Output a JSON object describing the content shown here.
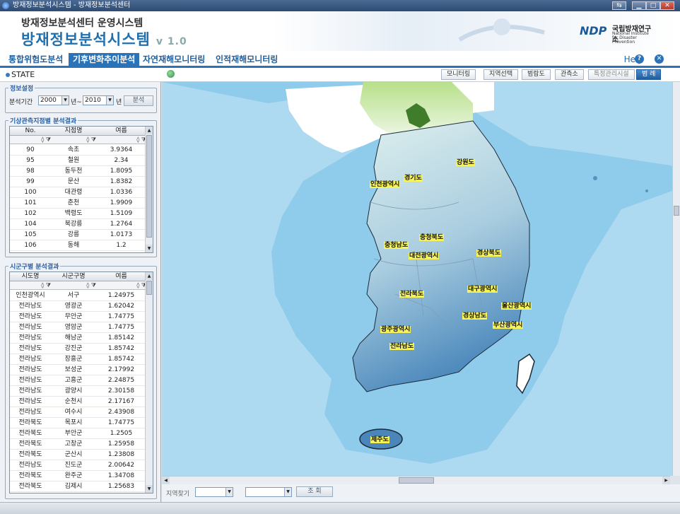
{
  "window": {
    "title": "방재정보분석시스템 - 방재정보분석센터"
  },
  "header": {
    "subtitle": "방재정보분석센터 운영시스템",
    "title": "방재정보분석시스템",
    "version": "v 1.0",
    "logo_mark": "NDP",
    "logo_kr": "국립방재연구소",
    "logo_en1": "National Institute",
    "logo_en2": "for Disaster Prevention"
  },
  "menu": {
    "items": [
      "통합위험도분석",
      "기후변화추이분석",
      "자연재해모니터링",
      "인적재해모니터링"
    ],
    "active": 1,
    "help": "Help"
  },
  "state": {
    "label": "STATE"
  },
  "toolbar": {
    "buttons": [
      "모니터링",
      "지역선택",
      "범람도",
      "관측소",
      "특정관리시설",
      "범 례"
    ]
  },
  "info": {
    "legend": "정보설정",
    "period_label": "분석기간",
    "from_year": "2000",
    "to_sep": "년~",
    "to_year": "2010",
    "year_suffix": "년",
    "analyze": "분석"
  },
  "station": {
    "legend": "기상관측지점별 분석결과",
    "headers": [
      "No.",
      "지점명",
      "여름"
    ],
    "rows": [
      [
        "90",
        "속초",
        "3.9364"
      ],
      [
        "95",
        "철원",
        "2.34"
      ],
      [
        "98",
        "동두천",
        "1.8095"
      ],
      [
        "99",
        "문산",
        "1.8382"
      ],
      [
        "100",
        "대관령",
        "1.0336"
      ],
      [
        "101",
        "춘천",
        "1.9909"
      ],
      [
        "102",
        "백령도",
        "1.5109"
      ],
      [
        "104",
        "북강릉",
        "1.2764"
      ],
      [
        "105",
        "강릉",
        "1.0173"
      ],
      [
        "106",
        "동해",
        "1.2"
      ]
    ]
  },
  "district": {
    "legend": "시군구별 분석결과",
    "headers": [
      "시도명",
      "시군구명",
      "여름"
    ],
    "rows": [
      [
        "인천광역시",
        "서구",
        "1.24975"
      ],
      [
        "전라남도",
        "영광군",
        "1.62042"
      ],
      [
        "전라남도",
        "무안군",
        "1.74775"
      ],
      [
        "전라남도",
        "영암군",
        "1.74775"
      ],
      [
        "전라남도",
        "해남군",
        "1.85142"
      ],
      [
        "전라남도",
        "강진군",
        "1.85742"
      ],
      [
        "전라남도",
        "장흥군",
        "1.85742"
      ],
      [
        "전라남도",
        "보성군",
        "2.17992"
      ],
      [
        "전라남도",
        "고흥군",
        "2.24875"
      ],
      [
        "전라남도",
        "광양시",
        "2.30158"
      ],
      [
        "전라남도",
        "순천시",
        "2.17167"
      ],
      [
        "전라남도",
        "여수시",
        "2.43908"
      ],
      [
        "전라북도",
        "목포시",
        "1.74775"
      ],
      [
        "전라북도",
        "부안군",
        "1.2505"
      ],
      [
        "전라북도",
        "고창군",
        "1.25958"
      ],
      [
        "전라북도",
        "군산시",
        "1.23808"
      ],
      [
        "전라남도",
        "진도군",
        "2.00642"
      ],
      [
        "전라북도",
        "완주군",
        "1.34708"
      ],
      [
        "전라북도",
        "김제시",
        "1.25683"
      ]
    ]
  },
  "map": {
    "labels": [
      "강원도",
      "경기도",
      "인천광역시",
      "충청북도",
      "충청남도",
      "대전광역시",
      "경상북도",
      "전라북도",
      "대구광역시",
      "울산광역시",
      "경상남도",
      "부산광역시",
      "광주광역시",
      "전라남도",
      "제주도"
    ]
  },
  "search": {
    "label": "지역찾기",
    "button": "조 회"
  },
  "colors": {
    "accent": "#2a73b8",
    "sea": "#8fcbea",
    "label_bg": "#f6f35a"
  }
}
